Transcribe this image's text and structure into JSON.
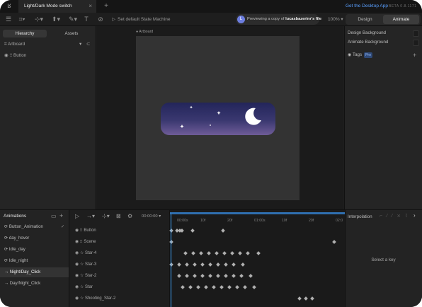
{
  "titlebar": {
    "tab_title": "Light/Dark Mode switch",
    "close_glyph": "×",
    "add_glyph": "+",
    "desktop_link": "Get the Desktop App",
    "beta": "BETA 0.8.1171"
  },
  "toolbar": {
    "state_machine": "Set default State Machine",
    "preview_avatar": "L",
    "preview_prefix": "Previewing a copy of ",
    "preview_owner": "lucasbazerinr's file",
    "zoom": "100%",
    "mode_design": "Design",
    "mode_animate": "Animate"
  },
  "left_panel": {
    "tab_hierarchy": "Hierarchy",
    "tab_assets": "Assets",
    "tree": [
      {
        "label": "Artboard"
      },
      {
        "label": "Button"
      }
    ]
  },
  "stage": {
    "artboard_label": "Artboard"
  },
  "right_panel": {
    "design_background": "Design Background",
    "animate_background": "Animate Background",
    "tags": "Tags",
    "pro": "Pro",
    "add_glyph": "+"
  },
  "animations": {
    "title": "Animations",
    "items": [
      {
        "label": "Button_Animation"
      },
      {
        "label": "day_hover"
      },
      {
        "label": "Idle_day"
      },
      {
        "label": "Idle_night"
      },
      {
        "label": "Night/Day_Click"
      },
      {
        "label": "Day/Night_Click"
      }
    ],
    "selected_index": 4
  },
  "timeline": {
    "time": "00:00:00",
    "ruler": [
      "00:00s",
      "10f",
      "20f",
      "01:00s",
      "10f",
      "20f",
      "02:0"
    ],
    "tracks": [
      {
        "label": "Button"
      },
      {
        "label": "Scene"
      },
      {
        "label": "Star-4"
      },
      {
        "label": "Star-3"
      },
      {
        "label": "Star-2"
      },
      {
        "label": "Star"
      },
      {
        "label": "Shooting_Star-2"
      }
    ]
  },
  "interpolation": {
    "title": "Interpolation",
    "empty": "Select a key"
  },
  "colors": {
    "accent": "#3ea5ff",
    "switch_top": "#23255a",
    "switch_bottom": "#6f5c98"
  }
}
